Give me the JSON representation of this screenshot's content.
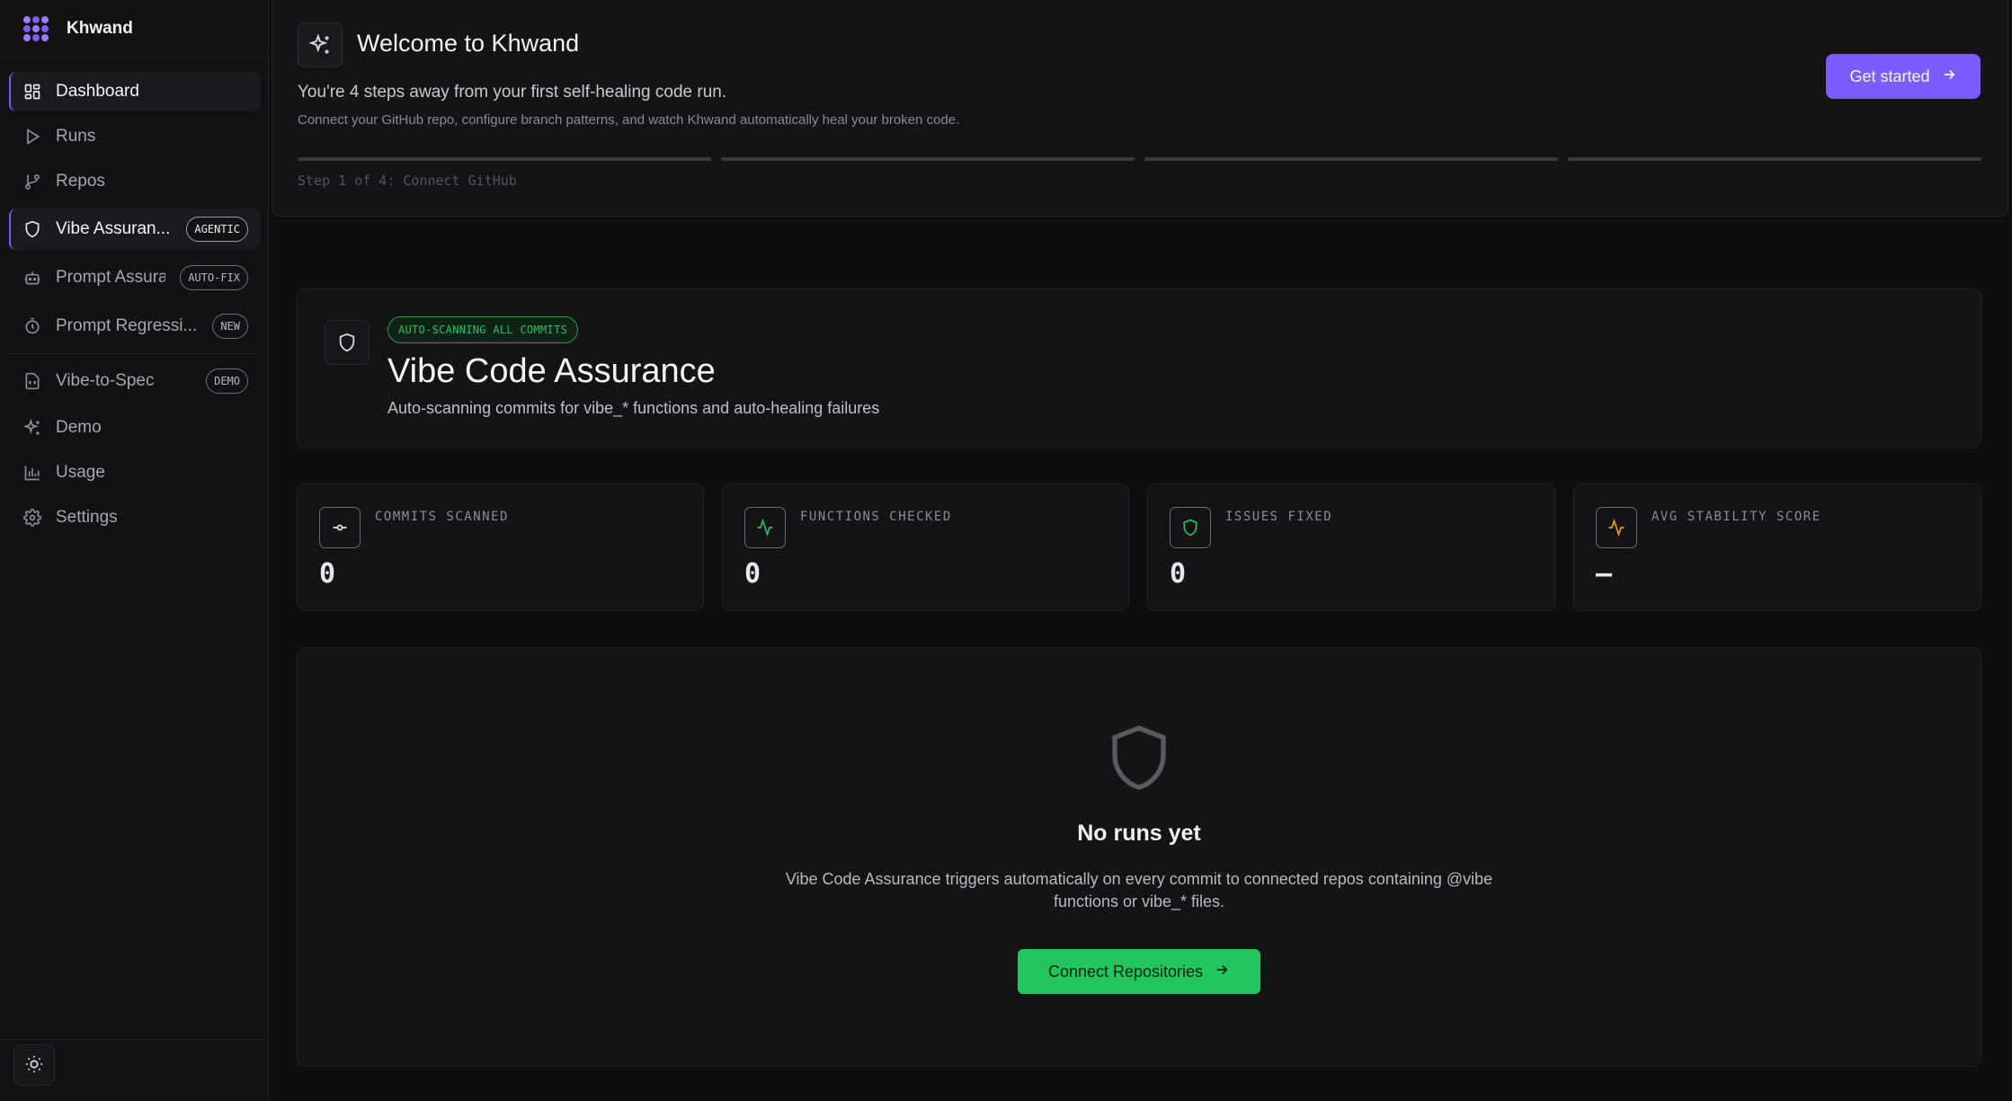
{
  "app": {
    "name": "Khwand"
  },
  "sidebar": {
    "items": [
      {
        "label": "Dashboard",
        "icon": "dashboard-icon",
        "active": true,
        "badge": ""
      },
      {
        "label": "Runs",
        "icon": "play-icon",
        "active": false,
        "badge": ""
      },
      {
        "label": "Repos",
        "icon": "git-branch-icon",
        "active": false,
        "badge": ""
      },
      {
        "label": "Vibe Assuran...",
        "icon": "shield-icon",
        "active": true,
        "badge": "AGENTIC"
      },
      {
        "label": "Prompt Assura",
        "icon": "bot-icon",
        "active": false,
        "badge": "AUTO-FIX"
      },
      {
        "label": "Prompt Regressi...",
        "icon": "timer-icon",
        "active": false,
        "badge": "NEW"
      },
      {
        "label": "Vibe-to-Spec",
        "icon": "file-code-icon",
        "active": false,
        "badge": "DEMO"
      },
      {
        "label": "Demo",
        "icon": "sparkles-icon",
        "active": false,
        "badge": ""
      },
      {
        "label": "Usage",
        "icon": "bar-chart-icon",
        "active": false,
        "badge": ""
      },
      {
        "label": "Settings",
        "icon": "gear-icon",
        "active": false,
        "badge": ""
      }
    ]
  },
  "welcome": {
    "title": "Welcome to Khwand",
    "subtitle": "You're 4 steps away from your first self-healing code run.",
    "description": "Connect your GitHub repo, configure branch patterns, and watch Khwand automatically heal your broken code.",
    "button": "Get started",
    "step_text": "Step 1 of 4: Connect GitHub",
    "steps_total": 4,
    "steps_completed": 0
  },
  "hero": {
    "pill": "AUTO-SCANNING ALL COMMITS",
    "title": "Vibe Code Assurance",
    "subtitle": "Auto-scanning commits for vibe_* functions and auto-healing failures"
  },
  "stats": [
    {
      "label": "COMMITS SCANNED",
      "value": "0",
      "icon": "git-commit-icon",
      "color": "#e4e4e8"
    },
    {
      "label": "FUNCTIONS CHECKED",
      "value": "0",
      "icon": "activity-icon",
      "color": "#22c55e"
    },
    {
      "label": "ISSUES FIXED",
      "value": "0",
      "icon": "shield-check-icon",
      "color": "#22c55e"
    },
    {
      "label": "AVG STABILITY SCORE",
      "value": "—",
      "icon": "activity-icon",
      "color": "#f59e0b"
    }
  ],
  "empty": {
    "title": "No runs yet",
    "description": "Vibe Code Assurance triggers automatically on every commit to connected repos containing @vibe functions or vibe_* files.",
    "button": "Connect Repositories"
  },
  "colors": {
    "accent": "#7c5cff",
    "success": "#22c55e",
    "warning": "#f59e0b"
  }
}
